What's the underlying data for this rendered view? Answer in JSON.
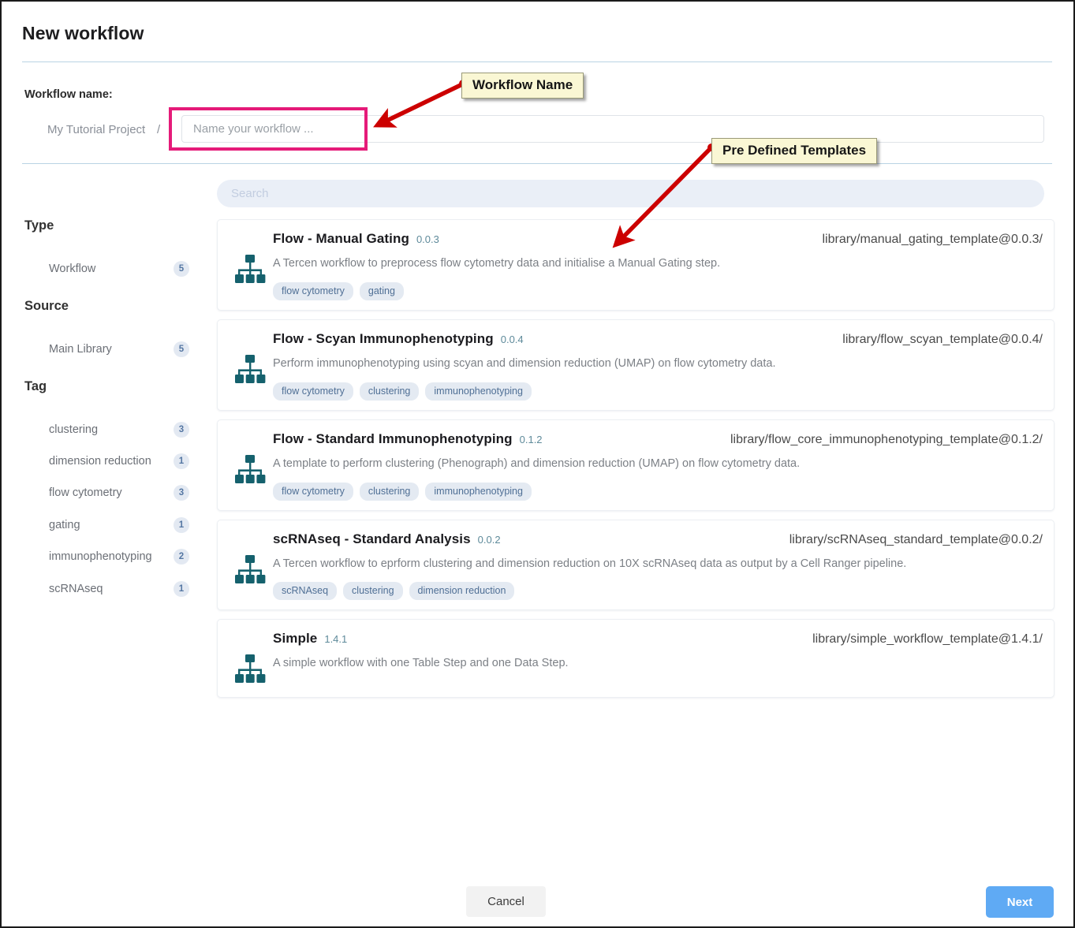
{
  "dialog": {
    "title": "New workflow"
  },
  "workflow_name": {
    "label": "Workflow name:",
    "project": "My Tutorial Project",
    "separator": "/",
    "input_value": "",
    "input_placeholder": "Name your workflow ..."
  },
  "search": {
    "placeholder": "Search",
    "value": ""
  },
  "facets": [
    {
      "title": "Type",
      "options": [
        {
          "label": "Workflow",
          "count": "5"
        }
      ]
    },
    {
      "title": "Source",
      "options": [
        {
          "label": "Main Library",
          "count": "5"
        }
      ]
    },
    {
      "title": "Tag",
      "options": [
        {
          "label": "clustering",
          "count": "3"
        },
        {
          "label": "dimension reduction",
          "count": "1"
        },
        {
          "label": "flow cytometry",
          "count": "3"
        },
        {
          "label": "gating",
          "count": "1"
        },
        {
          "label": "immunophenotyping",
          "count": "2"
        },
        {
          "label": "scRNAseq",
          "count": "1"
        }
      ]
    }
  ],
  "templates": [
    {
      "icon": "sitemap-icon",
      "title": "Flow - Manual Gating",
      "version": "0.0.3",
      "path": "library/manual_gating_template@0.0.3/",
      "description": "A Tercen workflow to preprocess flow cytometry data and initialise a Manual Gating step.",
      "tags": [
        "flow cytometry",
        "gating"
      ]
    },
    {
      "icon": "sitemap-icon",
      "title": "Flow - Scyan Immunophenotyping",
      "version": "0.0.4",
      "path": "library/flow_scyan_template@0.0.4/",
      "description": "Perform immunophenotyping using scyan and dimension reduction (UMAP) on flow cytometry data.",
      "tags": [
        "flow cytometry",
        "clustering",
        "immunophenotyping"
      ]
    },
    {
      "icon": "sitemap-icon",
      "title": "Flow - Standard Immunophenotyping",
      "version": "0.1.2",
      "path": "library/flow_core_immunophenotyping_template@0.1.2/",
      "description": "A template to perform clustering (Phenograph) and dimension reduction (UMAP) on flow cytometry data.",
      "tags": [
        "flow cytometry",
        "clustering",
        "immunophenotyping"
      ]
    },
    {
      "icon": "sitemap-icon",
      "title": "scRNAseq - Standard Analysis",
      "version": "0.0.2",
      "path": "library/scRNAseq_standard_template@0.0.2/",
      "description": "A Tercen workflow to eprform clustering and dimension reduction on 10X scRNAseq data as output by a Cell Ranger pipeline.",
      "tags": [
        "scRNAseq",
        "clustering",
        "dimension reduction"
      ]
    },
    {
      "icon": "sitemap-icon",
      "title": "Simple",
      "version": "1.4.1",
      "path": "library/simple_workflow_template@1.4.1/",
      "description": "A simple workflow with one Table Step and one Data Step.",
      "tags": []
    }
  ],
  "footer": {
    "cancel_label": "Cancel",
    "next_label": "Next"
  },
  "annotations": [
    {
      "name": "workflow-name-callout",
      "text": "Workflow Name"
    },
    {
      "name": "pre-defined-templates-callout",
      "text": "Pre Defined Templates"
    }
  ],
  "colors": {
    "accent_blue": "#5faaf4",
    "highlight_pink": "#e51b79",
    "annotation_red": "#cc0000",
    "callout_bg": "#faf7d4",
    "icon_teal": "#15616d",
    "tag_bg": "#e4eaf2",
    "tag_text": "#4f6f95"
  }
}
